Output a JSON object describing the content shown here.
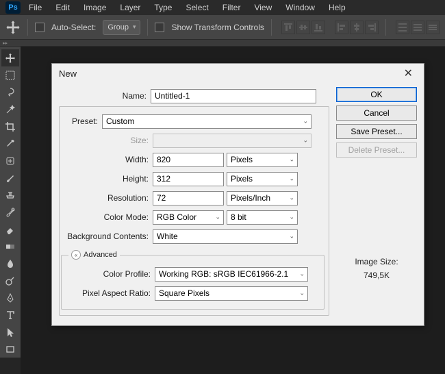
{
  "menubar": {
    "items": [
      "File",
      "Edit",
      "Image",
      "Layer",
      "Type",
      "Select",
      "Filter",
      "View",
      "Window",
      "Help"
    ]
  },
  "optionsbar": {
    "auto_select_label": "Auto-Select:",
    "group_label": "Group",
    "show_transform_label": "Show Transform Controls"
  },
  "dialog": {
    "title": "New",
    "name_label": "Name:",
    "name_value": "Untitled-1",
    "preset_label": "Preset:",
    "preset_value": "Custom",
    "size_label": "Size:",
    "size_value": "",
    "width_label": "Width:",
    "width_value": "820",
    "width_unit": "Pixels",
    "height_label": "Height:",
    "height_value": "312",
    "height_unit": "Pixels",
    "resolution_label": "Resolution:",
    "resolution_value": "72",
    "resolution_unit": "Pixels/Inch",
    "color_mode_label": "Color Mode:",
    "color_mode_value": "RGB Color",
    "color_depth_value": "8 bit",
    "bg_contents_label": "Background Contents:",
    "bg_contents_value": "White",
    "advanced_label": "Advanced",
    "color_profile_label": "Color Profile:",
    "color_profile_value": "Working RGB:  sRGB IEC61966-2.1",
    "pixel_aspect_label": "Pixel Aspect Ratio:",
    "pixel_aspect_value": "Square Pixels",
    "ok_label": "OK",
    "cancel_label": "Cancel",
    "save_preset_label": "Save Preset...",
    "delete_preset_label": "Delete Preset...",
    "image_size_label": "Image Size:",
    "image_size_value": "749,5K"
  }
}
